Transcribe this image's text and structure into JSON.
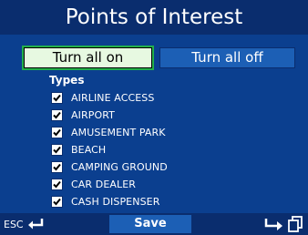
{
  "window": {
    "title": "Points of Interest"
  },
  "toolbar": {
    "turn_all_on": "Turn all on",
    "turn_all_off": "Turn all off"
  },
  "types": {
    "label": "Types",
    "items": [
      {
        "label": "AIRLINE ACCESS",
        "checked": true
      },
      {
        "label": "AIRPORT",
        "checked": true
      },
      {
        "label": "AMUSEMENT PARK",
        "checked": true
      },
      {
        "label": "BEACH",
        "checked": true
      },
      {
        "label": "CAMPING GROUND",
        "checked": true
      },
      {
        "label": "CAR DEALER",
        "checked": true
      },
      {
        "label": "CASH DISPENSER",
        "checked": true
      }
    ]
  },
  "bottombar": {
    "esc_label": "ESC",
    "save_label": "Save"
  },
  "colors": {
    "background": "#0b3f8f",
    "title_bar": "#0a2d6e",
    "active_button": "#e7f9e1",
    "active_outline": "#23b04a",
    "button_blue": "#1c5fb5"
  }
}
